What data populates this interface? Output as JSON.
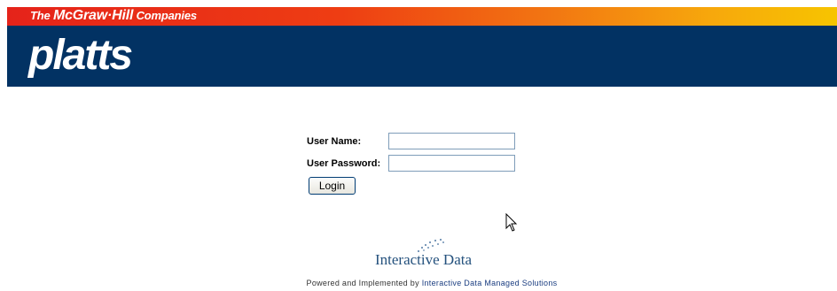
{
  "header": {
    "company_prefix": "The ",
    "company_name": "McGraw·Hill",
    "company_suffix": " Companies",
    "logo_text": "platts"
  },
  "login": {
    "username_label": "User Name:",
    "username_value": "",
    "password_label": "User Password:",
    "password_value": "",
    "login_button": "Login"
  },
  "branding": {
    "partner_logo_text": "Interactive Data",
    "footer_text": "Powered and Implemented by ",
    "footer_link": "Interactive Data Managed Solutions"
  },
  "colors": {
    "header_navy": "#023263",
    "gradient_start": "#e5231a",
    "gradient_end": "#f7c400",
    "partner_blue": "#24517d"
  },
  "icons": {
    "cursor": "mouse-pointer-icon",
    "partner_dots": "dot-arc-icon"
  }
}
